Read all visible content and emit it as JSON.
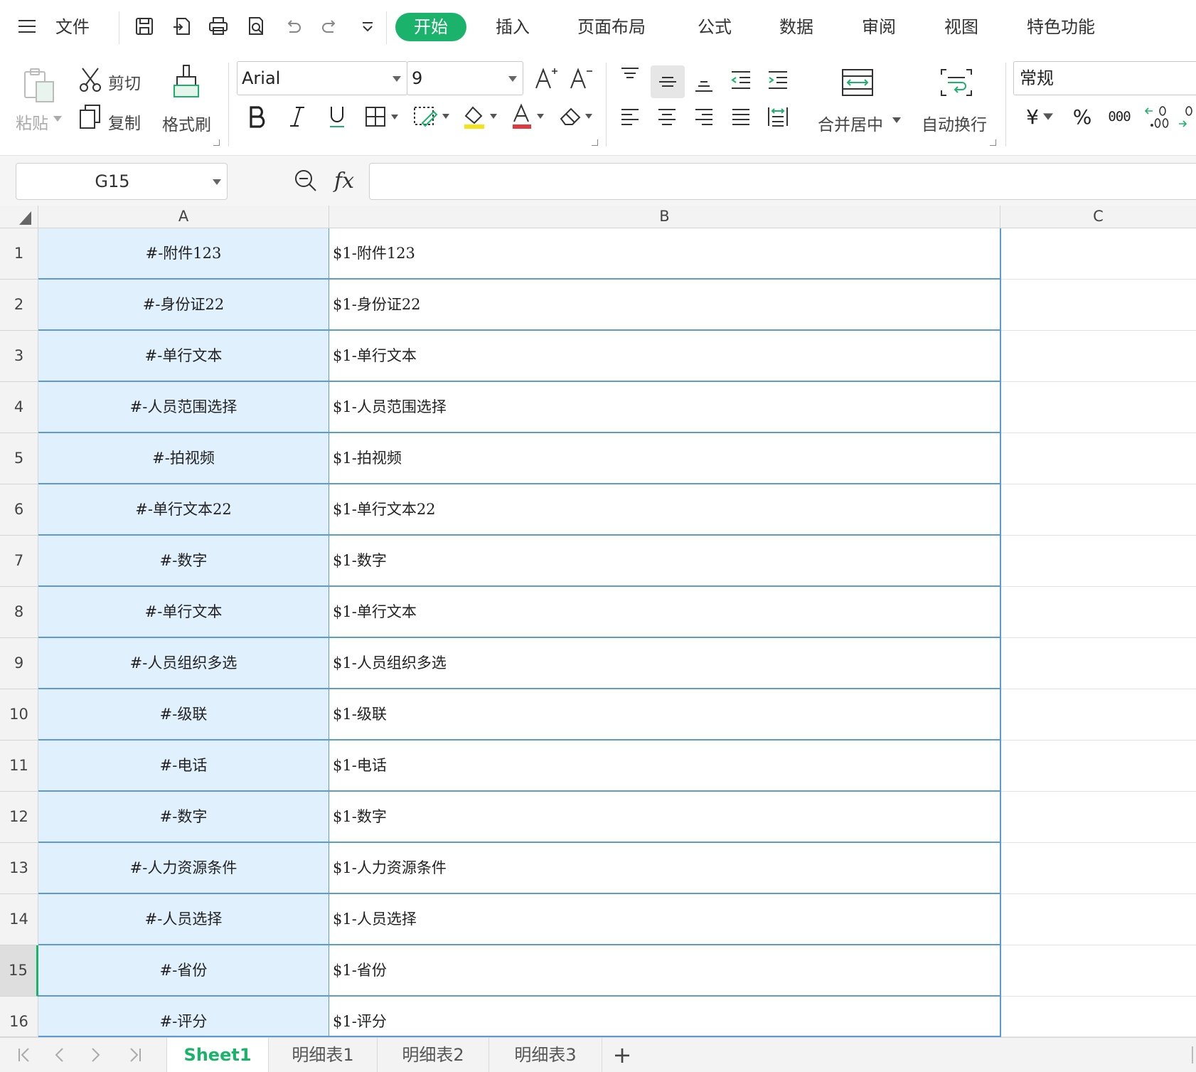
{
  "menu": {
    "file": "文件",
    "tabs": [
      "开始",
      "插入",
      "页面布局",
      "公式",
      "数据",
      "审阅",
      "视图",
      "特色功能"
    ]
  },
  "ribbon": {
    "paste": "粘贴",
    "cut": "剪切",
    "copy": "复制",
    "format_painter": "格式刷",
    "font": "Arial",
    "font_size": "9",
    "merge_center": "合并居中",
    "wrap_text": "自动换行",
    "number_format": "常规",
    "currency_symbol": "¥",
    "percent_symbol": "%",
    "thousands_symbol": "000"
  },
  "formula_bar": {
    "cell_ref": "G15",
    "fx": "fx",
    "value": ""
  },
  "grid": {
    "columns": [
      "A",
      "B",
      "C"
    ],
    "selected_row": 15,
    "rows": [
      {
        "n": "1",
        "a": "#-附件123",
        "b": "$1-附件123"
      },
      {
        "n": "2",
        "a": "#-身份证22",
        "b": "$1-身份证22"
      },
      {
        "n": "3",
        "a": "#-单行文本",
        "b": "$1-单行文本"
      },
      {
        "n": "4",
        "a": "#-人员范围选择",
        "b": "$1-人员范围选择"
      },
      {
        "n": "5",
        "a": "#-拍视频",
        "b": "$1-拍视频"
      },
      {
        "n": "6",
        "a": "#-单行文本22",
        "b": "$1-单行文本22"
      },
      {
        "n": "7",
        "a": "#-数字",
        "b": "$1-数字"
      },
      {
        "n": "8",
        "a": "#-单行文本",
        "b": "$1-单行文本"
      },
      {
        "n": "9",
        "a": "#-人员组织多选",
        "b": "$1-人员组织多选"
      },
      {
        "n": "10",
        "a": "#-级联",
        "b": "$1-级联"
      },
      {
        "n": "11",
        "a": "#-电话",
        "b": "$1-电话"
      },
      {
        "n": "12",
        "a": "#-数字",
        "b": "$1-数字"
      },
      {
        "n": "13",
        "a": "#-人力资源条件",
        "b": "$1-人力资源条件"
      },
      {
        "n": "14",
        "a": "#-人员选择",
        "b": "$1-人员选择"
      },
      {
        "n": "15",
        "a": "#-省份",
        "b": "$1-省份"
      },
      {
        "n": "16",
        "a": "#-评分",
        "b": "$1-评分"
      }
    ]
  },
  "sheets": [
    "Sheet1",
    "明细表1",
    "明细表2",
    "明细表3"
  ],
  "active_sheet": "Sheet1",
  "add_sheet": "+",
  "colors": {
    "accent": "#1bb36b",
    "selection_fill": "#e0f1fd",
    "selection_border": "#5b9bd5"
  }
}
